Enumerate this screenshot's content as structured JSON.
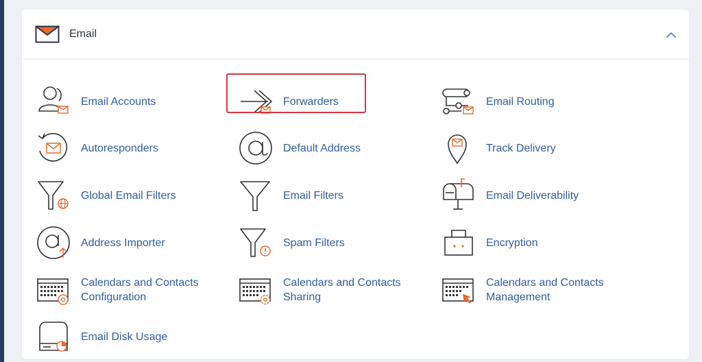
{
  "panel": {
    "title": "Email",
    "header_icon": "envelope-icon",
    "collapse_icon": "chevron-up-icon",
    "accent_color": "#e86a2c",
    "link_color": "#2f5e9e"
  },
  "items": [
    {
      "label": "Email Accounts",
      "icon": "user-mail-icon"
    },
    {
      "label": "Forwarders",
      "icon": "forward-arrow-icon",
      "highlighted": true
    },
    {
      "label": "Email Routing",
      "icon": "routing-icon"
    },
    {
      "label": "Autoresponders",
      "icon": "autoresponder-icon"
    },
    {
      "label": "Default Address",
      "icon": "at-sign-icon"
    },
    {
      "label": "Track Delivery",
      "icon": "map-pin-mail-icon"
    },
    {
      "label": "Global Email Filters",
      "icon": "filter-globe-icon"
    },
    {
      "label": "Email Filters",
      "icon": "filter-icon"
    },
    {
      "label": "Email Deliverability",
      "icon": "mailbox-icon"
    },
    {
      "label": "Address Importer",
      "icon": "at-import-icon"
    },
    {
      "label": "Spam Filters",
      "icon": "filter-warning-icon"
    },
    {
      "label": "Encryption",
      "icon": "briefcase-lock-icon"
    },
    {
      "label": "Calendars and Contacts\nConfiguration",
      "icon": "calendar-at-icon"
    },
    {
      "label": "Calendars and Contacts\nSharing",
      "icon": "calendar-share-icon"
    },
    {
      "label": "Calendars and Contacts\nManagement",
      "icon": "calendar-manage-icon"
    },
    {
      "label": "Email Disk Usage",
      "icon": "disk-usage-icon"
    }
  ]
}
